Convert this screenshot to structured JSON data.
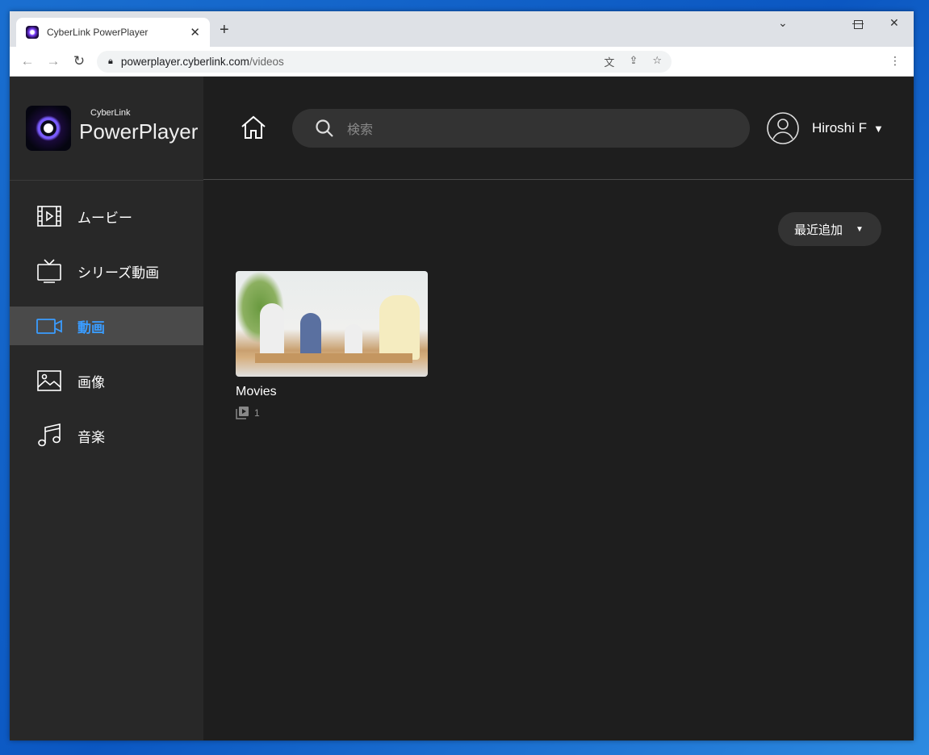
{
  "browser": {
    "tab_title": "CyberLink PowerPlayer",
    "url_domain": "powerplayer.cyberlink.com",
    "url_path": "/videos"
  },
  "app": {
    "logo_small": "CyberLink",
    "logo_big": "PowerPlayer",
    "sidebar": {
      "items": [
        {
          "label": "ムービー",
          "icon": "film-icon"
        },
        {
          "label": "シリーズ動画",
          "icon": "tv-icon"
        },
        {
          "label": "動画",
          "icon": "video-camera-icon",
          "active": true
        },
        {
          "label": "画像",
          "icon": "image-icon"
        },
        {
          "label": "音楽",
          "icon": "music-icon"
        }
      ]
    },
    "header": {
      "search_placeholder": "検索",
      "user_name": "Hiroshi F"
    },
    "sort": {
      "selected": "最近追加"
    },
    "cards": [
      {
        "title": "Movies",
        "count": "1"
      }
    ],
    "colors": {
      "accent": "#3a9cff",
      "sidebar": "#282828",
      "main": "#1e1e1e"
    }
  }
}
